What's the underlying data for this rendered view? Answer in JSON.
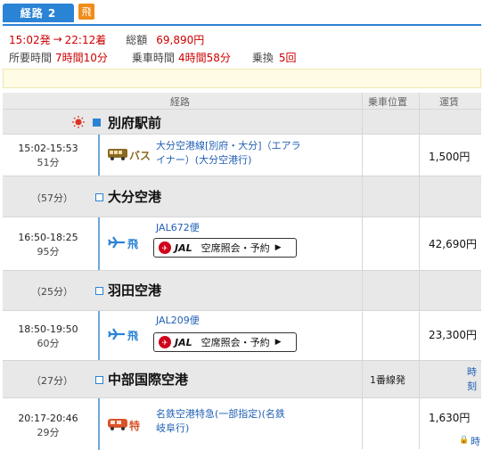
{
  "tab": {
    "label": "経路 2",
    "badge": "飛"
  },
  "summary": {
    "depart": "15:02発",
    "arrow": "→",
    "arrive": "22:12着",
    "total_label": "総額",
    "total": "69,890円",
    "time_label": "所要時間",
    "time_value": "7時間10分",
    "ride_label": "乗車時間",
    "ride_value": "4時間58分",
    "transfer_label": "乗換",
    "transfer_value": "5回"
  },
  "columns": {
    "route": "経路",
    "position": "乗車位置",
    "fare": "運賃"
  },
  "stations": [
    {
      "name": "別府駅前",
      "wait": ""
    },
    {
      "name": "大分空港",
      "wait": "（57分）"
    },
    {
      "name": "羽田空港",
      "wait": "（25分）"
    },
    {
      "name": "中部国際空港",
      "wait": "（27分）",
      "position": "1番線発",
      "extra": "時刻"
    }
  ],
  "segments": [
    {
      "time": "15:02-15:53",
      "dur": "51分",
      "mode": "バス",
      "line1": "大分空港線[別府・大分]（エアラ",
      "line2": "イナー）(大分空港行)",
      "fare": "1,500円"
    },
    {
      "time": "16:50-18:25",
      "dur": "95分",
      "mode": "飛",
      "line1": "JAL672便",
      "btn": "空席照会・予約",
      "fare": "42,690円"
    },
    {
      "time": "18:50-19:50",
      "dur": "60分",
      "mode": "飛",
      "line1": "JAL209便",
      "btn": "空席照会・予約",
      "fare": "23,300円"
    },
    {
      "time": "20:17-20:46",
      "dur": "29分",
      "mode": "特",
      "line1": "名鉄空港特急(一部指定)(名鉄",
      "line2": "岐阜行)",
      "fare": "1,630円",
      "extra": "時"
    }
  ],
  "jal_word": "JAL",
  "icons": {
    "sun": "sun-icon",
    "bus": "bus-icon",
    "plane": "plane-icon",
    "train": "train-icon"
  },
  "colors": {
    "accent": "#2b83d6",
    "red": "#cc0000",
    "link": "#2261b4"
  }
}
